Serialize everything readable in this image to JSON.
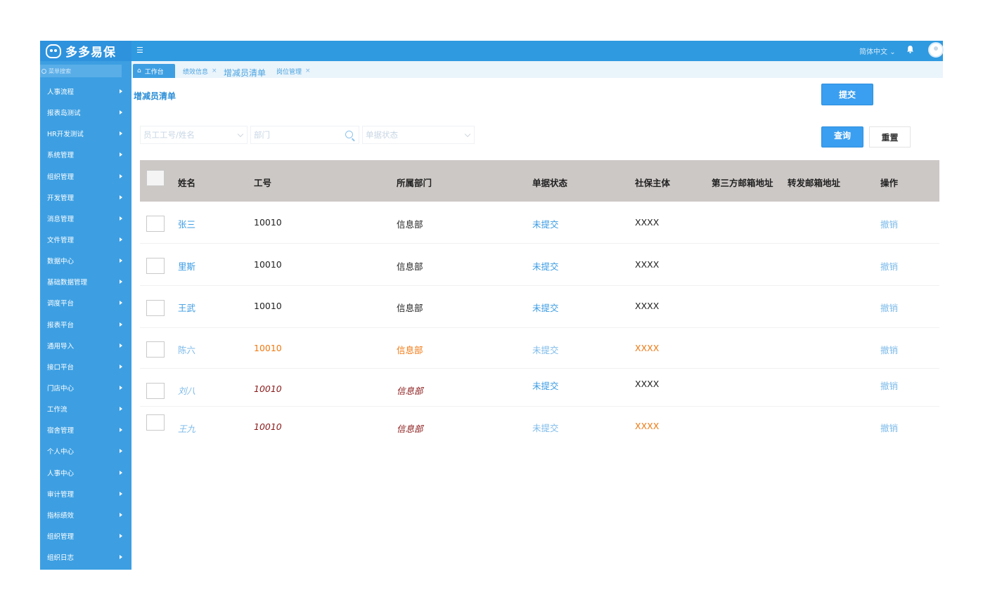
{
  "app": {
    "brand": "多多易保",
    "menu_search_placeholder": "菜单搜索",
    "language": "简体中文"
  },
  "sidebar": {
    "items": [
      {
        "label": "人事流程"
      },
      {
        "label": "报表岛测试"
      },
      {
        "label": "HR开发测试"
      },
      {
        "label": "系统管理"
      },
      {
        "label": "组织管理"
      },
      {
        "label": "开发管理"
      },
      {
        "label": "消息管理"
      },
      {
        "label": "文件管理"
      },
      {
        "label": "数据中心"
      },
      {
        "label": "基础数据管理"
      },
      {
        "label": "调度平台"
      },
      {
        "label": "报表平台"
      },
      {
        "label": "通用导入"
      },
      {
        "label": "接口平台"
      },
      {
        "label": "门店中心"
      },
      {
        "label": "工作流"
      },
      {
        "label": "宿舍管理"
      },
      {
        "label": "个人中心"
      },
      {
        "label": "人事中心"
      },
      {
        "label": "审计管理"
      },
      {
        "label": "指标绩效"
      },
      {
        "label": "组织管理"
      },
      {
        "label": "组织日志"
      }
    ]
  },
  "tabs": [
    {
      "label": "工作台"
    },
    {
      "label": "绩效信息"
    },
    {
      "label": "增减员清单"
    },
    {
      "label": "岗位管理"
    }
  ],
  "page": {
    "title": "增减员清单",
    "submit_label": "提交",
    "query_label": "查询",
    "reset_label": "重置"
  },
  "filters": {
    "employee_placeholder": "员工工号/姓名",
    "department_placeholder": "部门",
    "status_placeholder": "单据状态"
  },
  "table": {
    "columns": [
      "姓名",
      "工号",
      "所属部门",
      "单据状态",
      "社保主体",
      "第三方邮箱地址",
      "转发邮箱地址",
      "操作"
    ],
    "rows": [
      {
        "name": "张三",
        "id": "10010",
        "dept": "信息部",
        "status": "未提交",
        "entity": "XXXX",
        "action": "撤销"
      },
      {
        "name": "里斯",
        "id": "10010",
        "dept": "信息部",
        "status": "未提交",
        "entity": "XXXX",
        "action": "撤销"
      },
      {
        "name": "王武",
        "id": "10010",
        "dept": "信息部",
        "status": "未提交",
        "entity": "XXXX",
        "action": "撤销"
      },
      {
        "name": "陈六",
        "id": "10010",
        "dept": "信息部",
        "status": "未提交",
        "entity": "XXXX",
        "action": "撤销"
      },
      {
        "name": "刘八",
        "id": "10010",
        "dept": "信息部",
        "status": "未提交",
        "entity": "XXXX",
        "action": "撤销"
      },
      {
        "name": "王九",
        "id": "10010",
        "dept": "信息部",
        "status": "未提交",
        "entity": "XXXX",
        "action": "撤销"
      }
    ]
  },
  "colors": {
    "sidebar": "#3d9fe2",
    "header": "#2f9ae0",
    "accent": "#3a9ff0",
    "orange": "#f07810",
    "dark_red": "#8b1a1a"
  }
}
